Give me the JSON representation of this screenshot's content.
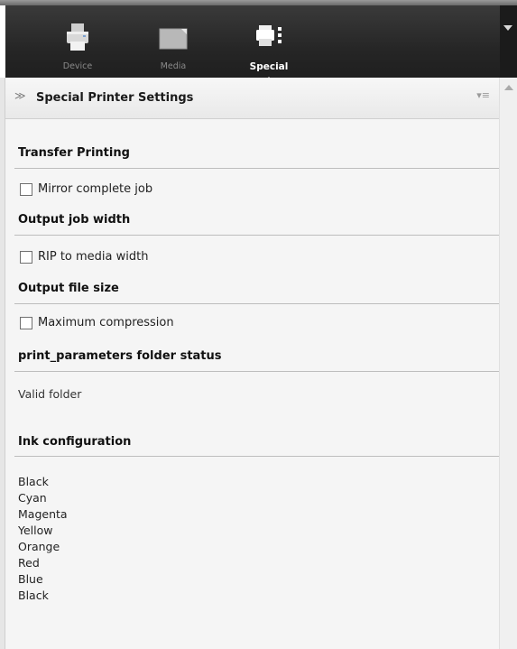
{
  "toolbar": {
    "tabs": [
      {
        "label": "Device",
        "icon": "printer-icon",
        "active": false
      },
      {
        "label": "Media",
        "icon": "media-icon",
        "active": false
      },
      {
        "label": "Special",
        "icon": "special-settings-icon",
        "active": true
      }
    ]
  },
  "panel": {
    "title": "Special Printer Settings"
  },
  "groups": {
    "transfer": {
      "title": "Transfer Printing",
      "option": "Mirror complete job",
      "checked": false
    },
    "width": {
      "title": "Output job width",
      "option": "RIP to media width",
      "checked": false
    },
    "filesize": {
      "title": "Output file size",
      "option": "Maximum compression",
      "checked": false
    },
    "folder": {
      "title": "print_parameters folder status",
      "status": "Valid folder"
    },
    "ink": {
      "title": "Ink configuration",
      "items": [
        "Black",
        "Cyan",
        "Magenta",
        "Yellow",
        "Orange",
        "Red",
        "Blue",
        "Black"
      ]
    }
  },
  "colors": {
    "toolbar_bg": "#262626",
    "panel_bg": "#f5f5f5",
    "accent_active": "#ffffff"
  }
}
